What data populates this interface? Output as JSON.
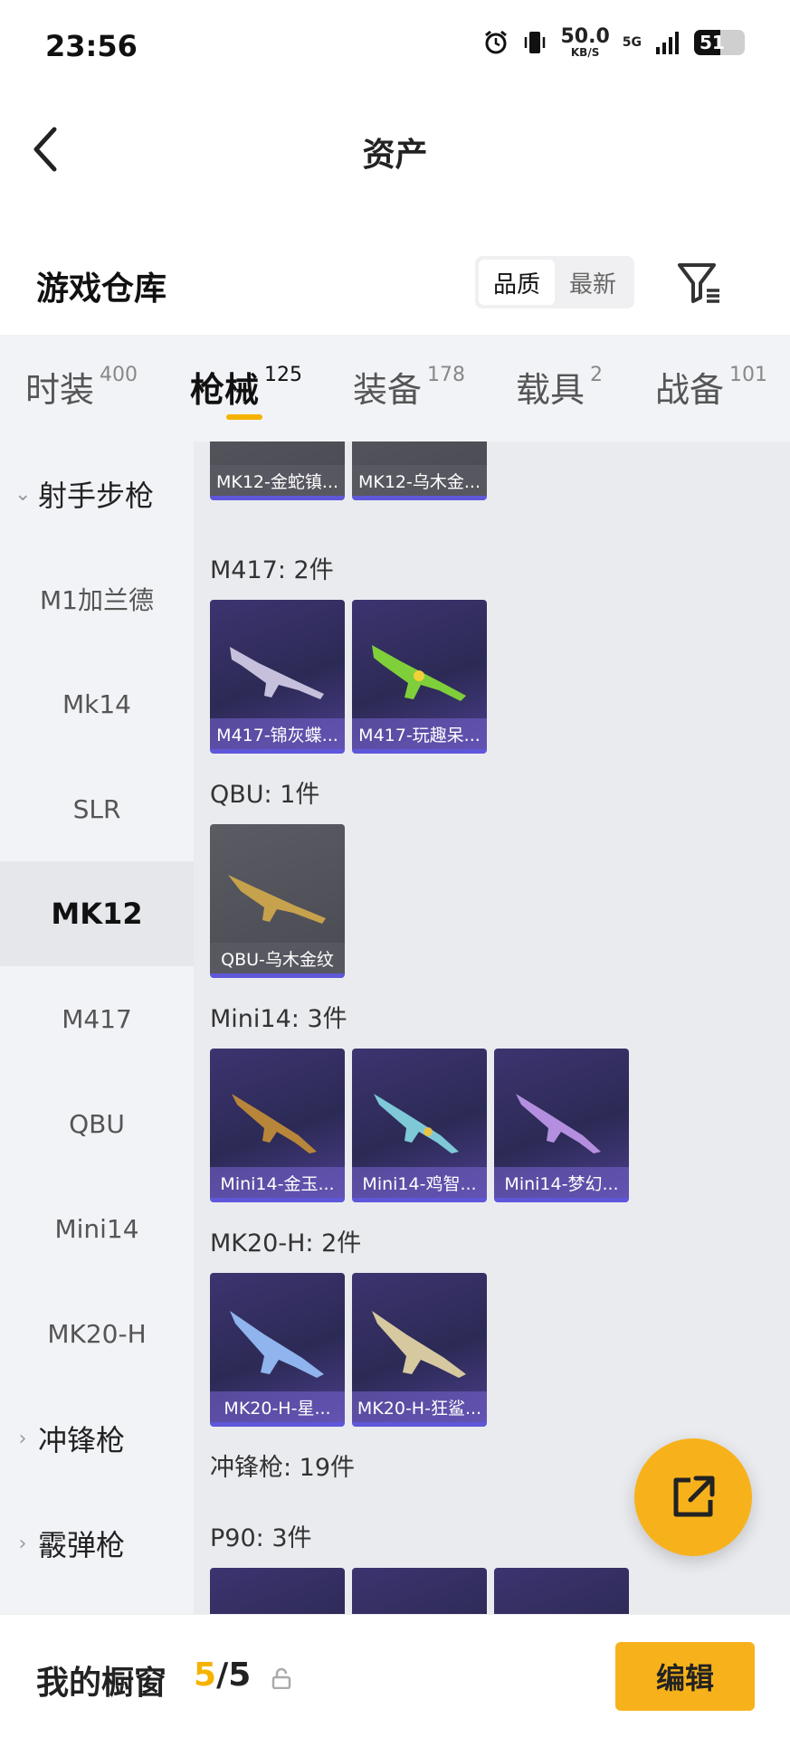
{
  "status_bar": {
    "time": "23:56",
    "net_speed": "50.0",
    "net_unit": "KB/S",
    "signal_label": "5G",
    "battery": "51",
    "battery_level": 0.51
  },
  "header": {
    "title": "资产",
    "back_icon": "chevron-left-icon"
  },
  "title_row": {
    "title": "游戏仓库",
    "sort_options": [
      "品质",
      "最新"
    ],
    "sort_selected": "品质",
    "filter_icon": "filter-icon"
  },
  "tabs": [
    {
      "label": "时装",
      "count": "400"
    },
    {
      "label": "枪械",
      "count": "125",
      "active": true
    },
    {
      "label": "装备",
      "count": "178"
    },
    {
      "label": "载具",
      "count": "2"
    },
    {
      "label": "战备",
      "count": "101"
    }
  ],
  "sidebar": {
    "group_1": "射手步枪",
    "items": [
      "M1加兰德",
      "Mk14",
      "SLR",
      "MK12",
      "M417",
      "QBU",
      "Mini14",
      "MK20-H"
    ],
    "selected": "MK12",
    "group_2": "冲锋枪",
    "group_3": "霰弹枪"
  },
  "content": {
    "mk12": {
      "items": [
        "MK12-金蛇镇...",
        "MK12-乌木金..."
      ]
    },
    "m417": {
      "title": "M417: 2件",
      "items": [
        "M417-锦灰蝶...",
        "M417-玩趣呆..."
      ]
    },
    "qbu": {
      "title": "QBU: 1件",
      "items": [
        "QBU-乌木金纹"
      ]
    },
    "mini14": {
      "title": "Mini14: 3件",
      "items": [
        "Mini14-金玉...",
        "Mini14-鸡智...",
        "Mini14-梦幻..."
      ]
    },
    "mk20h": {
      "title": "MK20-H: 2件",
      "items": [
        "MK20-H-星...",
        "MK20-H-狂鲨..."
      ]
    },
    "smg_title": "冲锋枪: 19件",
    "p90": {
      "title": "P90: 3件"
    }
  },
  "fab": {
    "icon": "share-external-icon"
  },
  "bottom_bar": {
    "label": "我的橱窗",
    "current": "5",
    "total": "/5",
    "lock_icon": "lock-icon",
    "edit_label": "编辑"
  },
  "colors": {
    "accent": "#f7b21b",
    "card_purple": "#3d3470",
    "card_gray": "#55565e",
    "card_edge": "#5f57d9"
  }
}
